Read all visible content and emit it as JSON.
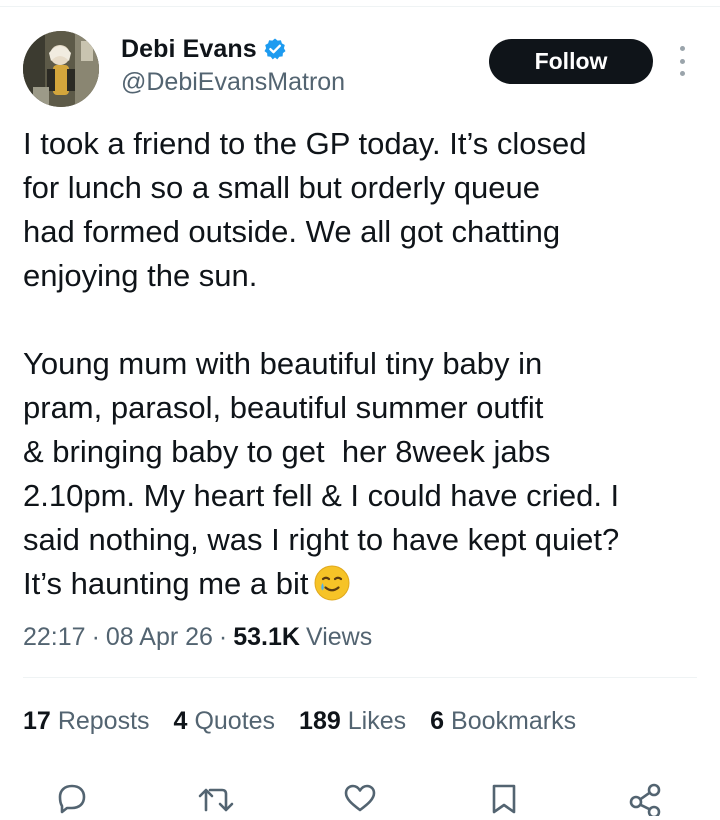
{
  "author": {
    "display_name": "Debi Evans",
    "handle": "@DebiEvansMatron",
    "verified": true,
    "verified_color": "#1d9bf0"
  },
  "follow_button": {
    "label": "Follow"
  },
  "tweet": {
    "paragraph_1": "I took a friend to the GP today. It’s closed\nfor lunch so a small but orderly queue\nhad formed outside. We all got chatting\nenjoying the sun.",
    "paragraph_2": "Young mum with beautiful tiny baby in\npram, parasol, beautiful summer outfit\n& bringing baby to get  her 8week jabs\n2.10pm. My heart fell & I could have cried. I\nsaid nothing, was I right to have kept quiet?\nIt’s haunting me a bit",
    "emoji": "smiling-face-with-tear"
  },
  "meta": {
    "time": "22:17",
    "separator": "·",
    "date": "08 Apr 26",
    "views_count": "53.1K",
    "views_label": "Views"
  },
  "stats": [
    {
      "count": "17",
      "label": "Reposts"
    },
    {
      "count": "4",
      "label": "Quotes"
    },
    {
      "count": "189",
      "label": "Likes"
    },
    {
      "count": "6",
      "label": "Bookmarks"
    }
  ],
  "actions": [
    "reply-icon",
    "repost-icon",
    "like-icon",
    "bookmark-icon",
    "share-icon"
  ],
  "colors": {
    "text_primary": "#0f1419",
    "text_secondary": "#536471",
    "follow_bg": "#0f1419"
  }
}
